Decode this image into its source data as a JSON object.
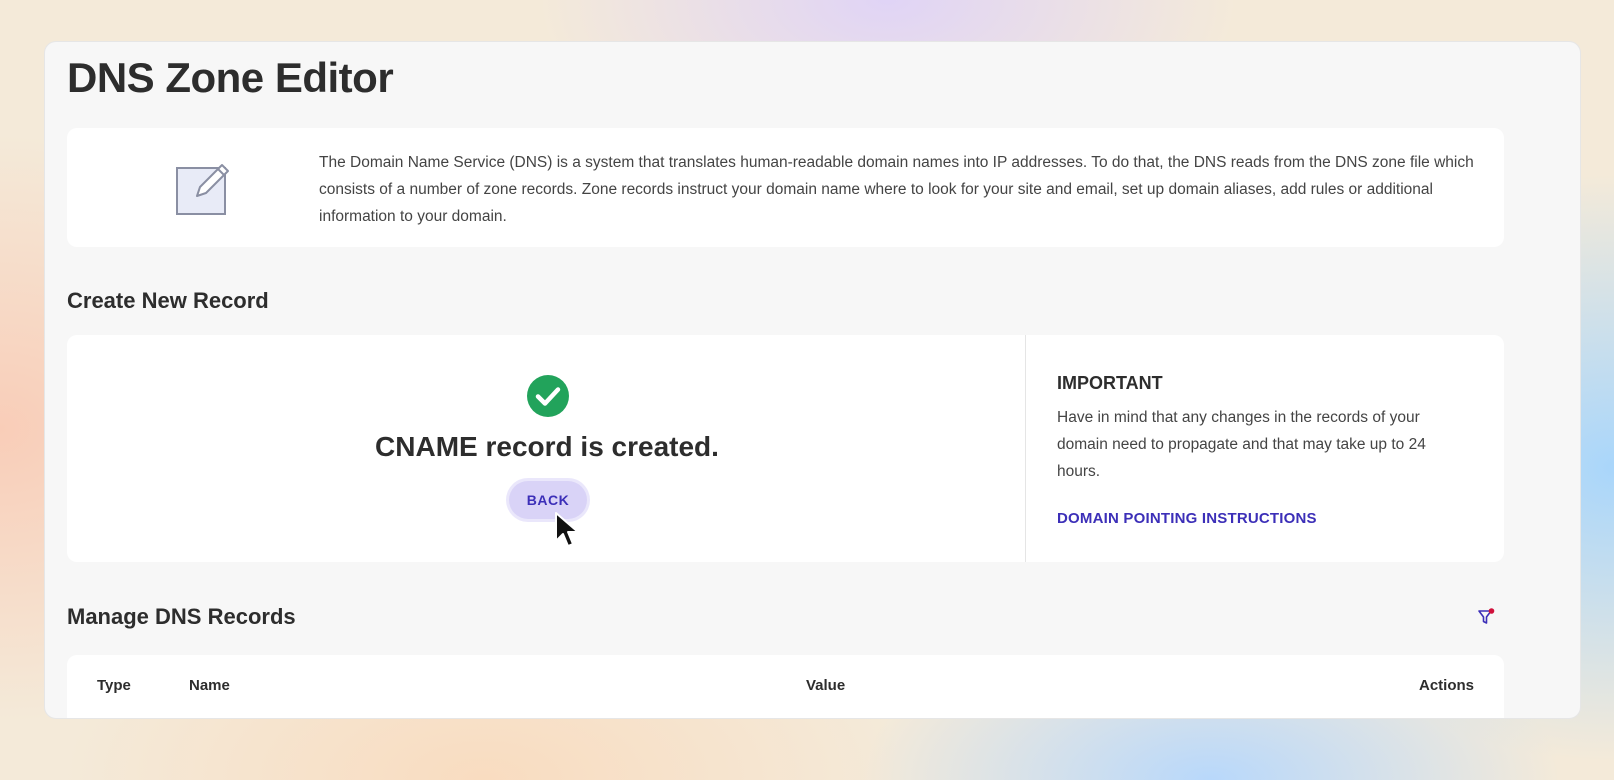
{
  "page": {
    "title": "DNS Zone Editor"
  },
  "info": {
    "icon": "edit-document-icon",
    "text": "The Domain Name Service (DNS) is a system that translates human-readable domain names into IP addresses. To do that, the DNS reads from the DNS zone file which consists of a number of zone records. Zone records instruct your domain name where to look for your site and email, set up domain aliases, add rules or additional information to your domain."
  },
  "create": {
    "section_title": "Create New Record",
    "status_icon": "check-circle-icon",
    "success_message": "CNAME record is created.",
    "back_label": "BACK",
    "important_title": "IMPORTANT",
    "important_text": "Have in mind that any changes in the records of your domain need to propagate and that may take up to 24 hours.",
    "link_label": "DOMAIN POINTING INSTRUCTIONS"
  },
  "manage": {
    "section_title": "Manage DNS Records",
    "filter_icon": "filter-icon",
    "columns": [
      "Type",
      "Name",
      "Value",
      "Actions"
    ]
  },
  "colors": {
    "accent": "#3c2fb8",
    "button_bg": "#d9d3f7",
    "success": "#22a35b",
    "filter_dot": "#d0103a"
  }
}
